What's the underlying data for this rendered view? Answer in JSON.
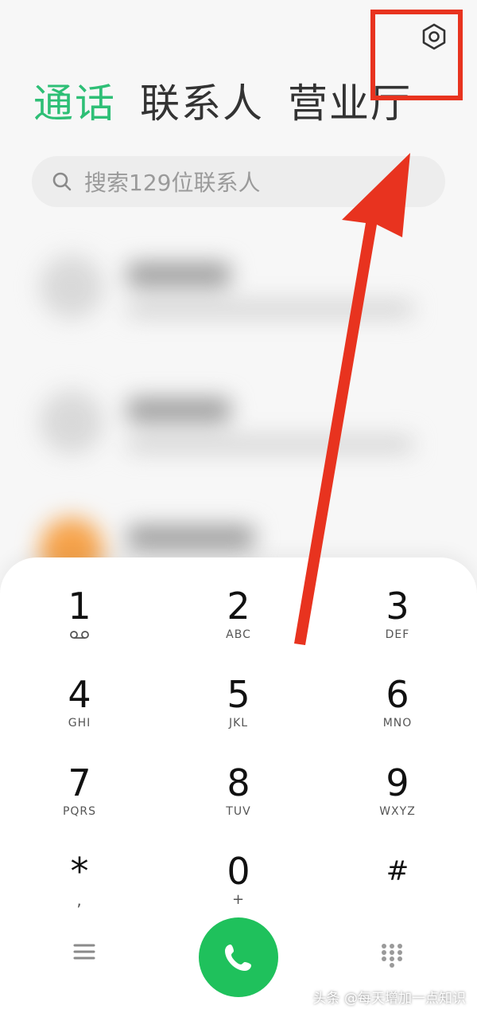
{
  "tabs": {
    "calls": "通话",
    "contacts": "联系人",
    "service_hall": "营业厅"
  },
  "search": {
    "placeholder": "搜索129位联系人"
  },
  "dialpad": {
    "keys": [
      {
        "digit": "1",
        "sub": ""
      },
      {
        "digit": "2",
        "sub": "ABC"
      },
      {
        "digit": "3",
        "sub": "DEF"
      },
      {
        "digit": "4",
        "sub": "GHI"
      },
      {
        "digit": "5",
        "sub": "JKL"
      },
      {
        "digit": "6",
        "sub": "MNO"
      },
      {
        "digit": "7",
        "sub": "PQRS"
      },
      {
        "digit": "8",
        "sub": "TUV"
      },
      {
        "digit": "9",
        "sub": "WXYZ"
      },
      {
        "digit": "*",
        "sub": ","
      },
      {
        "digit": "0",
        "sub": "+"
      },
      {
        "digit": "#",
        "sub": ""
      }
    ]
  },
  "icons": {
    "settings": "settings-icon",
    "search": "search-icon",
    "voicemail": "voicemail-icon",
    "menu": "menu-icon",
    "call": "phone-icon",
    "keypad": "keypad-icon"
  },
  "colors": {
    "accent": "#2ebf76",
    "call_button": "#1fc15c",
    "annotation": "#e8331f"
  },
  "watermark": "头条 @每天增加一点知识"
}
